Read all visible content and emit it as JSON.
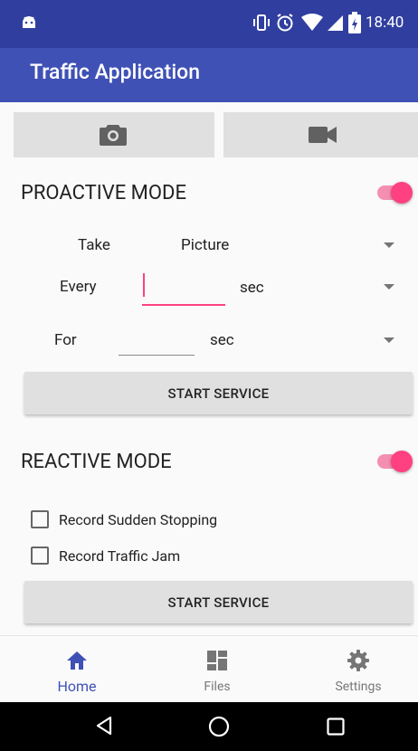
{
  "status_bar": {
    "time": "18:40",
    "icons": [
      "android-icon",
      "vibrate-icon",
      "alarm-icon",
      "wifi-icon",
      "signal-icon",
      "battery-icon"
    ]
  },
  "app_bar": {
    "title": "Traffic Application"
  },
  "top_buttons": [
    "camera-icon",
    "videocam-icon"
  ],
  "proactive": {
    "title": "PROACTIVE MODE",
    "enabled": true,
    "take_label": "Take",
    "take_value": "Picture",
    "every_label": "Every",
    "every_value": "",
    "every_unit": "sec",
    "for_label": "For",
    "for_value": "",
    "for_unit": "sec",
    "start_label": "START SERVICE"
  },
  "reactive": {
    "title": "REACTIVE MODE",
    "enabled": true,
    "options": [
      {
        "label": "Record Sudden Stopping",
        "checked": false
      },
      {
        "label": "Record Traffic Jam",
        "checked": false
      }
    ],
    "start_label": "START SERVICE"
  },
  "bottom_nav": [
    {
      "label": "Home",
      "icon": "home-icon",
      "active": true
    },
    {
      "label": "Files",
      "icon": "dashboard-icon",
      "active": false
    },
    {
      "label": "Settings",
      "icon": "gear-icon",
      "active": false
    }
  ],
  "nav_bar": [
    "back-icon",
    "home-circle-icon",
    "recents-icon"
  ],
  "colors": {
    "primary": "#3f51b5",
    "primary_dark": "#303f9f",
    "accent": "#ff4081",
    "nav_active": "#3f51b5"
  }
}
